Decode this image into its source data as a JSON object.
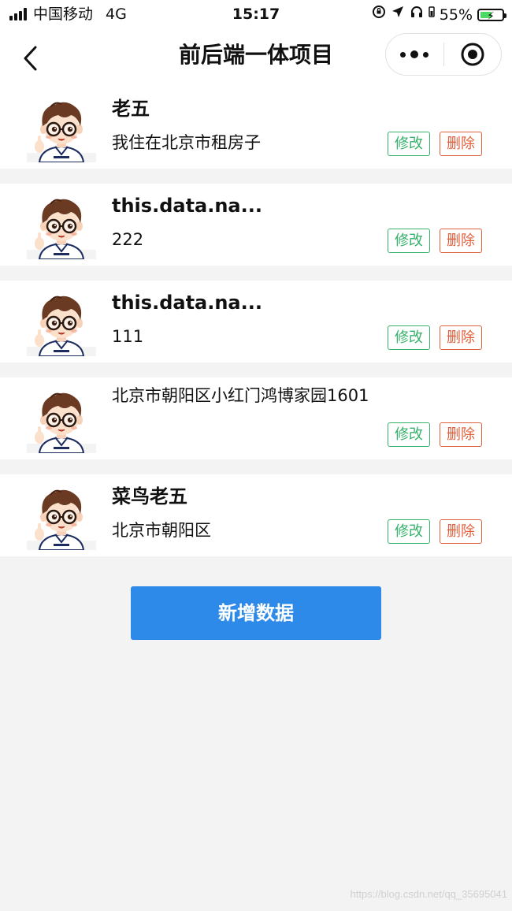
{
  "status_bar": {
    "carrier": "中国移动",
    "network": "4G",
    "time": "15:17",
    "battery_percent": "55%",
    "battery_level": 0.55,
    "icons": [
      "rotation-lock-icon",
      "location-arrow-icon",
      "headphones-icon",
      "battery-icon"
    ]
  },
  "nav": {
    "title": "前后端一体项目",
    "back_icon": "chevron-left-icon",
    "menu_icon": "more-dots-icon",
    "close_icon": "target-circle-icon"
  },
  "list": {
    "items": [
      {
        "name": "老五",
        "address": "我住在北京市租房子",
        "edit_label": "修改",
        "delete_label": "删除"
      },
      {
        "name": "this.data.na...",
        "address": "222",
        "edit_label": "修改",
        "delete_label": "删除"
      },
      {
        "name": "this.data.na...",
        "address": "111",
        "edit_label": "修改",
        "delete_label": "删除"
      },
      {
        "name": "",
        "address": "北京市朝阳区小红门鸿博家园1601",
        "edit_label": "修改",
        "delete_label": "删除"
      },
      {
        "name": "菜鸟老五",
        "address": "北京市朝阳区",
        "edit_label": "修改",
        "delete_label": "删除"
      }
    ]
  },
  "add_button": {
    "label": "新增数据"
  },
  "watermark": "https://blog.csdn.net/qq_35695041",
  "colors": {
    "edit": "#35b26a",
    "delete": "#e0603c",
    "primary": "#2e8ae8",
    "background": "#f3f3f3",
    "battery_fill": "#4cd964"
  }
}
